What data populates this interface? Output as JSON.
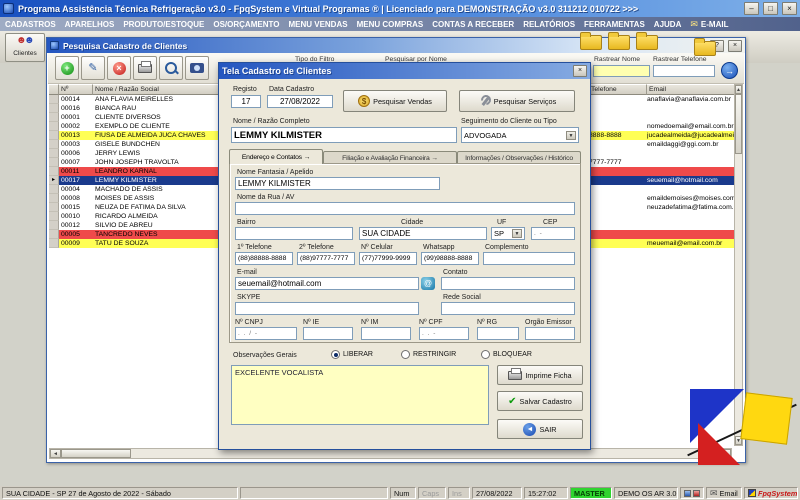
{
  "app": {
    "title": "Programa Assistência Técnica Refrigeração v3.0 - FpqSystem e Virtual Programas ® | Licenciado para  DEMONSTRAÇÃO v3.0 311212 010722 >>>",
    "menu_items": [
      "CADASTROS",
      "APARELHOS",
      "PRODUTO/ESTOQUE",
      "OS/ORÇAMENTO",
      "MENU VENDAS",
      "MENU COMPRAS",
      "CONTAS A RECEBER",
      "RELATÓRIOS",
      "FERRAMENTAS",
      "AJUDA"
    ],
    "email_menu": "E-MAIL",
    "toolbar": {
      "clientes": "Clientes"
    }
  },
  "search_window": {
    "title": "Pesquisa Cadastro de Clientes",
    "filter": {
      "tipo_label": "Tipo do Filtro",
      "nome_label": "Pesquisar por Nome",
      "rastrear_nome_label": "Rastrear Nome",
      "rastrear_telefone_label": "Rastrear Telefone"
    },
    "grid": {
      "col_num": "Nº",
      "col_nome": "Nome / Razão Social",
      "col_telefone": "Telefone",
      "col_email": "Email",
      "rows": [
        {
          "num": "00014",
          "nome": "ANA FLAVIA MEIRELLES",
          "telefone": "",
          "email": "anaflavia@anaflavia.com.br",
          "hl": "none"
        },
        {
          "num": "00016",
          "nome": "BIANCA RAU",
          "telefone": "",
          "email": "",
          "hl": "none"
        },
        {
          "num": "00001",
          "nome": "CLIENTE DIVERSOS",
          "telefone": "",
          "email": "",
          "hl": "none"
        },
        {
          "num": "00002",
          "nome": "EXEMPLO DE CLIENTE",
          "telefone": "",
          "email": "nomedoemail@email.com.br",
          "hl": "none"
        },
        {
          "num": "00013",
          "nome": "FIUSA DE ALMEIDA JUCA CHAVES",
          "telefone": "8888-8888",
          "email": "jucadealmeida@jucadealmeida.com.br",
          "hl": "yellow"
        },
        {
          "num": "00003",
          "nome": "GISELE BUNDCHEN",
          "telefone": "",
          "email": "emaildaggi@ggi.com.br",
          "hl": "none"
        },
        {
          "num": "00006",
          "nome": "JERRY LEWIS",
          "telefone": "",
          "email": "",
          "hl": "none"
        },
        {
          "num": "00007",
          "nome": "JOHN JOSEPH TRAVOLTA",
          "telefone": "7777-7777",
          "email": "",
          "hl": "none"
        },
        {
          "num": "00011",
          "nome": "LEANDRO KARNAL",
          "telefone": "",
          "email": "",
          "hl": "red"
        },
        {
          "num": "00017",
          "nome": "LEMMY KILMISTER",
          "telefone": "",
          "email": "seuemail@hotmail.com",
          "hl": "selected"
        },
        {
          "num": "00004",
          "nome": "MACHADO DE ASSIS",
          "telefone": "",
          "email": "",
          "hl": "none"
        },
        {
          "num": "00008",
          "nome": "MOISES DE ASSIS",
          "telefone": "",
          "email": "emaildemoises@moises.com.br",
          "hl": "none"
        },
        {
          "num": "00015",
          "nome": "NEUZA DE FATIMA DA SILVA",
          "telefone": "",
          "email": "neuzadefatima@fatima.com.br",
          "hl": "none"
        },
        {
          "num": "00010",
          "nome": "RICARDO ALMEIDA",
          "telefone": "",
          "email": "",
          "hl": "none"
        },
        {
          "num": "00012",
          "nome": "SILVIO DE ABREU",
          "telefone": "",
          "email": "",
          "hl": "none"
        },
        {
          "num": "00005",
          "nome": "TANCREDO NEVES",
          "telefone": "",
          "email": "",
          "hl": "red"
        },
        {
          "num": "00009",
          "nome": "TATU DE SOUZA",
          "telefone": "",
          "email": "meuemail@email.com.br",
          "hl": "yellow"
        }
      ]
    }
  },
  "dialog": {
    "title": "Tela Cadastro de Clientes",
    "registro_label": "Registo",
    "registro_value": "17",
    "data_cadastro_label": "Data Cadastro",
    "data_cadastro_value": "27/08/2022",
    "btn_pesquisar_vendas": "Pesquisar Vendas",
    "btn_pesquisar_servicos": "Pesquisar Serviços",
    "nome_completo_label": "Nome / Razão Completo",
    "nome_completo_value": "LEMMY KILMISTER",
    "seguimento_label": "Seguimento do Cliente ou Tipo",
    "seguimento_value": "ADVOGADA",
    "tabs": [
      "Endereço e Contatos →",
      "Filiação e Avaliação Financeira →",
      "Informações / Observações / Histórico"
    ],
    "fields": {
      "nome_fantasia_label": "Nome Fantasia / Apelido",
      "nome_fantasia_value": "LEMMY KILMISTER",
      "rua_label": "Nome da Rua / AV",
      "rua_value": "",
      "bairro_label": "Bairro",
      "bairro_value": "",
      "cidade_label": "Cidade",
      "cidade_value": "SUA CIDADE",
      "uf_label": "UF",
      "uf_value": "SP",
      "cep_label": "CEP",
      "cep_mask": ".   -",
      "tel1_label": "1º Telefone",
      "tel1_value": "(88)88888-8888",
      "tel2_label": "2º Telefone",
      "tel2_value": "(88)97777-7777",
      "celular_label": "Nº Celular",
      "celular_value": "(77)77999-9999",
      "whatsapp_label": "Whatsapp",
      "whatsapp_value": "(99)98888-8888",
      "complemento_label": "Complemento",
      "complemento_value": "",
      "email_label": "E-mail",
      "email_value": "seuemail@hotmail.com",
      "contato_label": "Contato",
      "contato_value": "",
      "skype_label": "SKYPE",
      "skype_value": "",
      "rede_social_label": "Rede Social",
      "rede_social_value": "",
      "cnpj_label": "Nº CNPJ",
      "cnpj_mask": ".  .  /  -",
      "ie_label": "Nº IE",
      "im_label": "Nº IM",
      "cpf_label": "Nº CPF",
      "cpf_mask": ".  .  -",
      "rg_label": "Nº RG",
      "orgao_label": "Orgão Emissor"
    },
    "obs": {
      "label": "Observações Gerais",
      "radio_liberar": "LIBERAR",
      "radio_restringir": "RESTRINGIR",
      "radio_bloquear": "BLOQUEAR",
      "selected": "LIBERAR",
      "memo": "EXCELENTE VOCALISTA"
    },
    "buttons": {
      "imprime": "Imprime Ficha",
      "salvar": "Salvar Cadastro",
      "sair": "SAIR"
    }
  },
  "statusbar": {
    "left": "SUA CIDADE - SP 27 de Agosto de 2022 - Sábado",
    "num": "Num",
    "caps": "Caps",
    "ins": "Ins",
    "date": "27/08/2022",
    "time": "15:27:02",
    "master": "MASTER",
    "demo": "DEMO OS AR 3.0",
    "email": "Email",
    "brand": "FpqSystem"
  },
  "icons": {
    "minimize": "–",
    "maximize": "□",
    "close": "×",
    "help": "?",
    "go": "→",
    "dropdown": "▼",
    "mail": "✉",
    "at": "@",
    "dollar": "$",
    "plus": "+",
    "delete": "×",
    "pencil": "✎",
    "check": "✔",
    "back": "◄",
    "selected_row": "▸"
  },
  "colors": {
    "titlebar_blue": "#1850c0",
    "row_selected": "#1a3a8c",
    "row_alert_red": "#ef4a4a",
    "row_highlight_yellow": "#ffff55",
    "memo_yellow": "#ffffc2",
    "master_green": "#2fd42f",
    "brand_red": "#c81818"
  }
}
